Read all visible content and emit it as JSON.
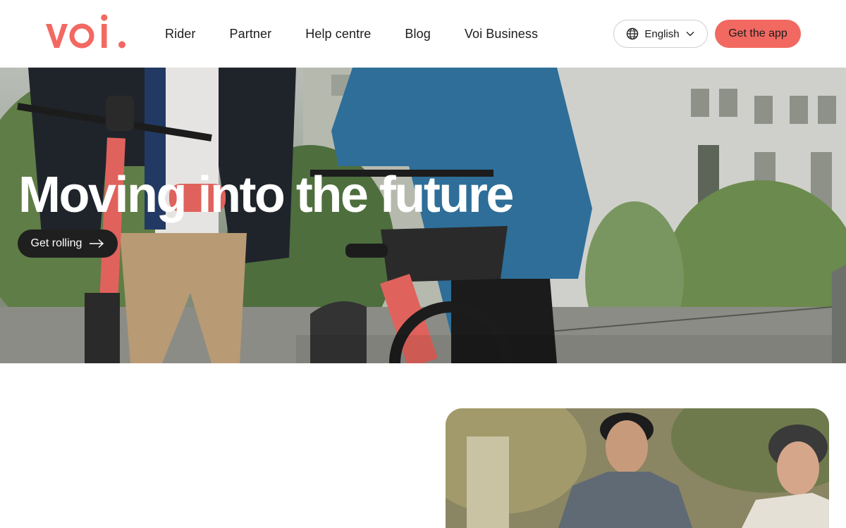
{
  "brand": {
    "logo_text": "voi.",
    "accent": "#f26961"
  },
  "nav": {
    "items": [
      {
        "label": "Rider"
      },
      {
        "label": "Partner"
      },
      {
        "label": "Help centre"
      },
      {
        "label": "Blog"
      },
      {
        "label": "Voi Business"
      }
    ]
  },
  "header": {
    "language": {
      "label": "English",
      "icon": "globe-icon"
    },
    "get_app_label": "Get the app"
  },
  "hero": {
    "title": "Moving into the future",
    "cta_label": "Get rolling"
  }
}
